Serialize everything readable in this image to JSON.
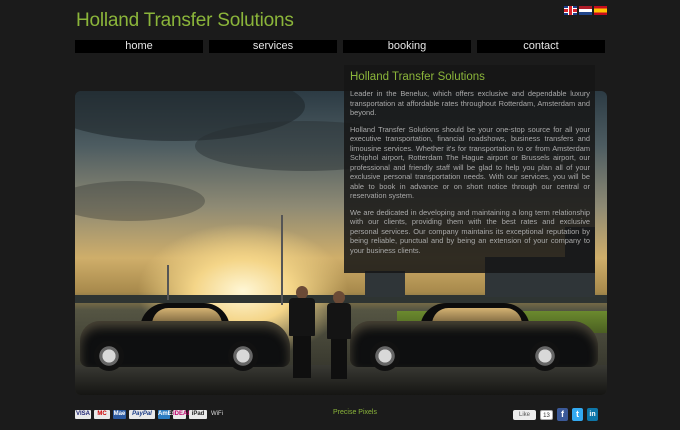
{
  "site_title": "Holland Transfer Solutions",
  "languages": [
    "English",
    "Nederlands",
    "Español"
  ],
  "nav": [
    {
      "label": "home"
    },
    {
      "label": "services"
    },
    {
      "label": "booking"
    },
    {
      "label": "contact"
    }
  ],
  "panel": {
    "title": "Holland Transfer Solutions",
    "paragraphs": [
      "Leader in the Benelux, which offers exclusive and dependable luxury transportation at affordable rates throughout Rotterdam, Amsterdam and beyond.",
      "Holland Transfer Solutions should be your one-stop source for all your executive transportation, financial roadshows, business transfers and limousine services. Whether it's for transportation to or from Amsterdam Schiphol airport, Rotterdam The Hague airport or Brussels airport, our professional and friendly staff will be glad to help you plan all of your exclusive personal transportation needs. With our services, you will be able to book in advance or on short notice through our central or reservation system.",
      "We are dedicated in developing and maintaining a long term relationship with our clients, providing them with the best rates and exclusive personal services. Our company maintains its exceptional reputation by being reliable, punctual and by being an extension of your company to your business clients."
    ]
  },
  "footer": {
    "payments": [
      "VISA",
      "MC",
      "Mae",
      "PayPal",
      "AmEx",
      "iDEAL",
      "iPad",
      "WiFi"
    ],
    "credit": "Precise Pixels",
    "like_label": "Like",
    "like_count": "13",
    "social_icons": [
      "facebook-icon",
      "twitter-icon",
      "linkedin-icon"
    ]
  },
  "colors": {
    "accent": "#8bb53a",
    "background": "#1b1b1b"
  }
}
